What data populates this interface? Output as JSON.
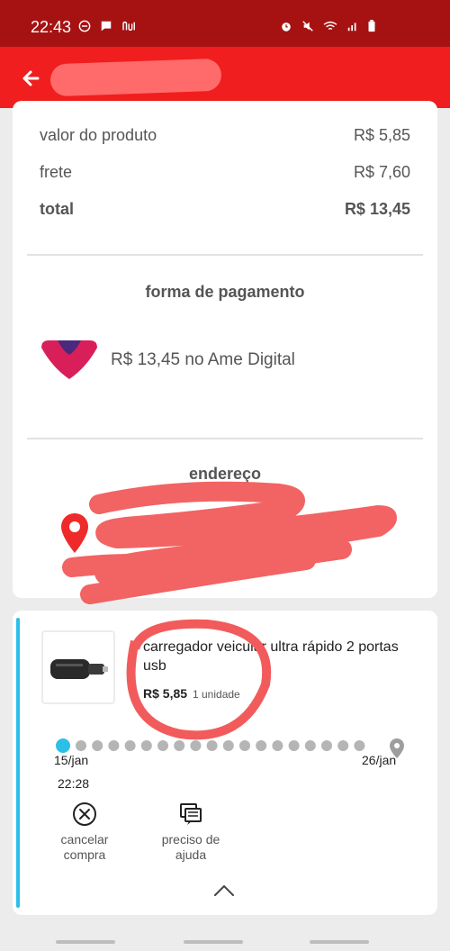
{
  "status_bar": {
    "time": "22:43",
    "icons_left": [
      "do-not-disturb-icon",
      "message-icon",
      "nubank-icon"
    ],
    "icons_right": [
      "alarm-icon",
      "mute-icon",
      "wifi-icon",
      "signal-icon",
      "battery-icon"
    ]
  },
  "header": {
    "back_icon": "arrow-left-icon",
    "title_redacted": true,
    "background": "#f01e1e"
  },
  "summary": {
    "rows": [
      {
        "label": "valor do produto",
        "value": "R$ 5,85"
      },
      {
        "label": "frete",
        "value": "R$ 7,60"
      },
      {
        "label": "total",
        "value": "R$ 13,45"
      }
    ]
  },
  "payment": {
    "title": "forma de pagamento",
    "text": "R$ 13,45 no Ame Digital",
    "logo": "ame-digital-logo"
  },
  "address": {
    "title": "endereço",
    "icon": "location-pin-icon",
    "content_redacted": true
  },
  "item": {
    "name": "carregador veicular ultra rápido 2 portas usb",
    "price": "R$ 5,85",
    "quantity": "1 unidade",
    "accent_color": "#2cc0e8"
  },
  "tracking": {
    "start_date": "15/jan",
    "start_time": "22:28",
    "end_date": "26/jan",
    "start_color": "#2cc0e8"
  },
  "actions": {
    "cancel_label_1": "cancelar",
    "cancel_label_2": "compra",
    "help_label_1": "preciso de",
    "help_label_2": "ajuda"
  }
}
